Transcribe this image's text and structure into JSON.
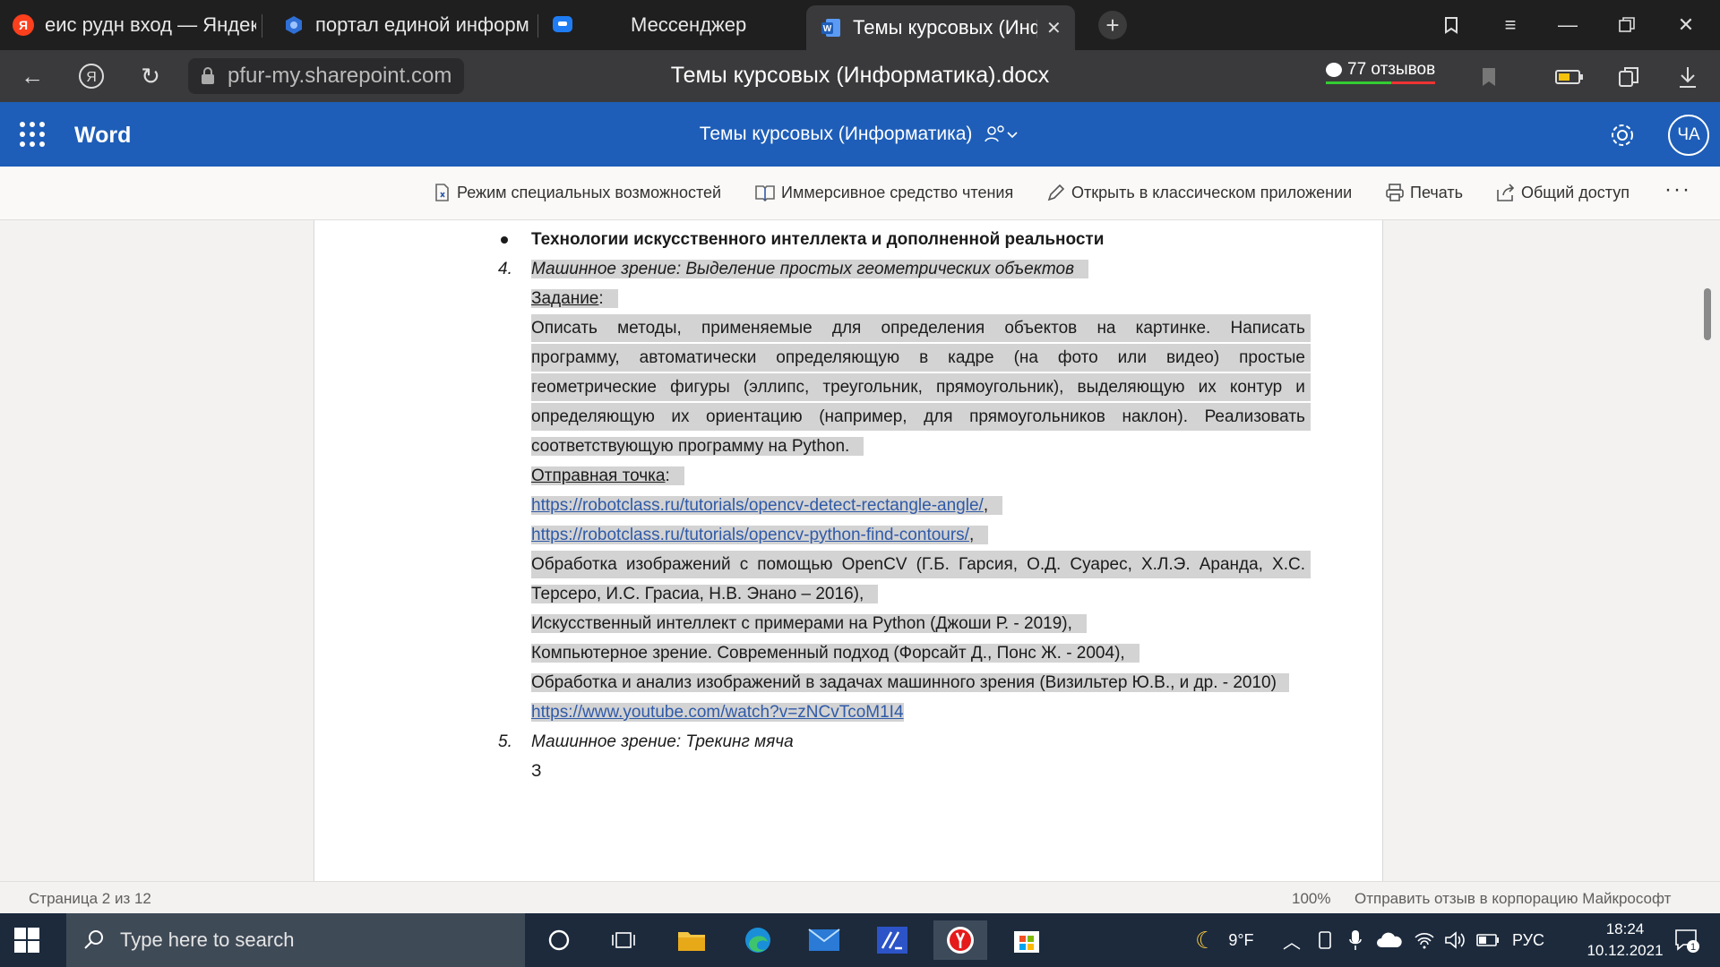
{
  "browser": {
    "tabs": [
      {
        "title": "еис рудн вход — Яндекс: н",
        "favicon": "yandex-icon"
      },
      {
        "title": "портал единой информац",
        "favicon": "portal-icon"
      },
      {
        "title": "Мессенджер",
        "favicon": "messenger-icon"
      },
      {
        "title": "Темы курсовых (Инфор",
        "favicon": "word-icon"
      }
    ],
    "url": "pfur-my.sharepoint.com",
    "page_title": "Темы курсовых (Информатика).docx",
    "reviews_count": "77",
    "reviews_label": "отзывов",
    "yandex_letter": "Я"
  },
  "word": {
    "app_name": "Word",
    "doc_title": "Темы курсовых (Информатика)",
    "avatar": "ЧА"
  },
  "commands": {
    "accessibility": "Режим специальных возможностей",
    "immersive": "Иммерсивное средство чтения",
    "open_desktop": "Открыть в классическом приложении",
    "print": "Печать",
    "share": "Общий доступ",
    "more": "···"
  },
  "document": {
    "section_heading": "Технологии искусственного интеллекта и дополненной реальности",
    "item4_num": "4.",
    "item4_title": "Машинное зрение: Выделение простых геометрических объектов",
    "task_label": "Задание",
    "colon": ":",
    "comma": ",",
    "task_lines": [
      [
        "Описать",
        "методы,",
        "применяемые",
        "для",
        "определения",
        "объектов",
        "на",
        "картинке.",
        "Написать"
      ],
      [
        "программу,",
        "автоматически",
        "определяющую",
        "в",
        "кадре",
        "(на",
        "фото",
        "или",
        "видео)",
        "простые"
      ],
      [
        "геометрические",
        "фигуры",
        "(эллипс,",
        "треугольник,",
        "прямоугольник),",
        "выделяющую",
        "их",
        "контур",
        "и"
      ],
      [
        "определяющую",
        "их",
        "ориентацию",
        "(например,",
        "для",
        "прямоугольников",
        "наклон).",
        "Реализовать"
      ]
    ],
    "task_last_line": "соответствующую программу на Python.",
    "start_label": "Отправная точка",
    "link1": "https://robotclass.ru/tutorials/opencv-detect-rectangle-angle/",
    "link2": "https://robotclass.ru/tutorials/opencv-python-find-contours/",
    "ref1_words": [
      "Обработка",
      "изображений",
      "с",
      "помощью",
      "OpenCV",
      "(Г.Б.",
      "Гарсия,",
      "О.Д.",
      "Суарес,",
      "Х.Л.Э.",
      "Аранда,",
      "Х.С."
    ],
    "ref1_line2": "Терсеро, И.С. Грасиа, Н.В. Энано – 2016),",
    "ref2": "Искусственный интеллект с примерами на Python (Джоши Р. - 2019),",
    "ref3": "Компьютерное зрение. Современный подход (Форсайт Д., Понс Ж. - 2004),",
    "ref4": "Обработка и анализ изображений в задачах машинного зрения (Визильтер Ю.В., и др. - 2010)",
    "link3": "https://www.youtube.com/watch?v=zNCvTcoM1I4",
    "item5_num": "5.",
    "item5_title": "Машинное зрение: Трекинг мяча",
    "item5_next": "З"
  },
  "status": {
    "page": "Страница 2 из 12",
    "zoom": "100%",
    "feedback": "Отправить отзыв в корпорацию Майкрософт"
  },
  "taskbar": {
    "search_placeholder": "Type here to search",
    "weather": "9°F",
    "lang": "РУС",
    "time": "18:24",
    "date": "10.12.2021",
    "notifications": "1"
  }
}
